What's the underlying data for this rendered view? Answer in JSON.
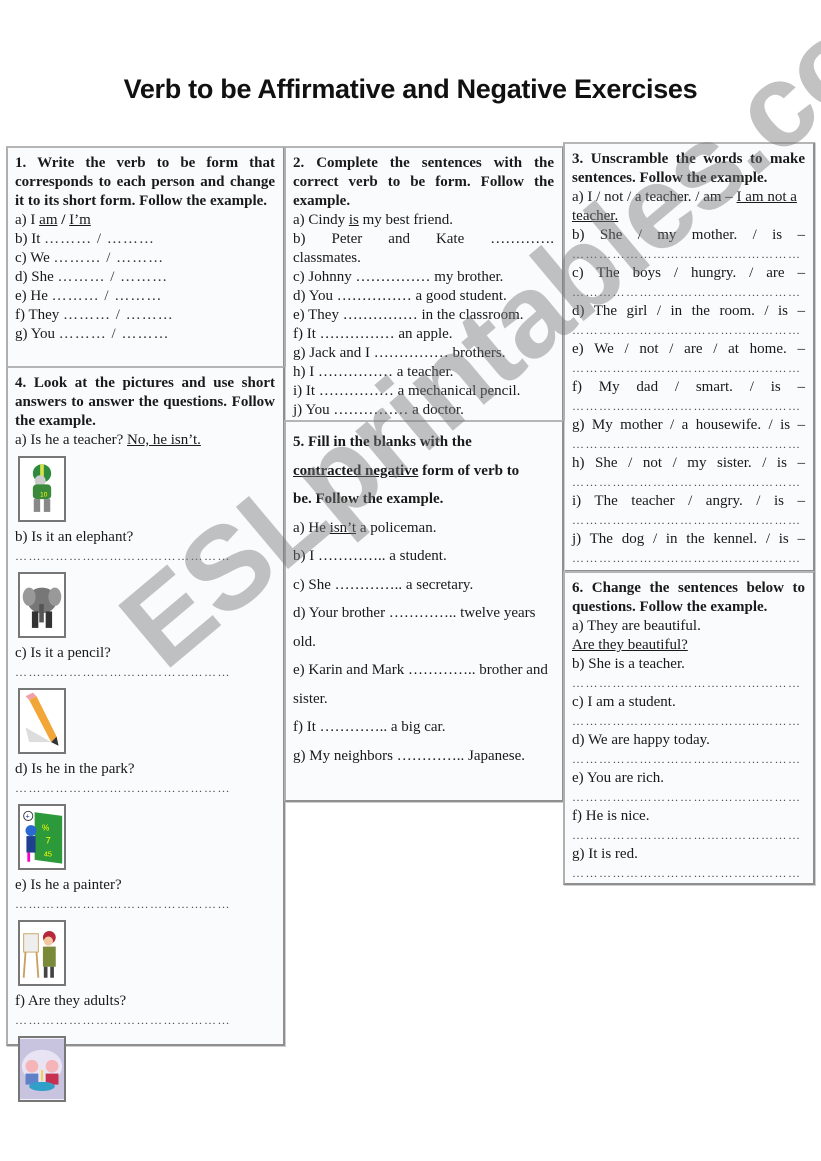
{
  "title": "Verb to be Affirmative and Negative Exercises",
  "watermark": "ESLprintables.com",
  "ex1": {
    "heading": "1. Write the verb to be form that corresponds to each person and change it to its short form. Follow the example.",
    "example": {
      "prefix": "a) I ",
      "answer1": "am",
      "sep": " / ",
      "answer2": "I’m"
    },
    "items": [
      {
        "label": "b) It",
        "blank": "……… / ………"
      },
      {
        "label": "c) We",
        "blank": "……… / ………"
      },
      {
        "label": "d) She",
        "blank": "……… / ………"
      },
      {
        "label": "e) He",
        "blank": "……… / ………"
      },
      {
        "label": "f) They",
        "blank": "……… / ………"
      },
      {
        "label": "g) You",
        "blank": "……… / ………"
      }
    ]
  },
  "ex2": {
    "heading": "2. Complete the sentences with the correct verb to be form. Follow the example.",
    "example": {
      "prefix": "a) Cindy ",
      "answer": "is",
      "suffix": " my best friend."
    },
    "item_b": {
      "line1": "b) Peter and Kate ………….",
      "line2": "classmates."
    },
    "items": [
      "c) Johnny …………… my brother.",
      "d) You …………… a good student.",
      "e) They …………… in the classroom.",
      "f) It …………… an apple.",
      "g) Jack and I …………… brothers.",
      "h) I …………… a teacher.",
      "i) It …………… a mechanical pencil.",
      "j) You …………… a doctor."
    ]
  },
  "ex3": {
    "heading": "3. Unscramble the words to make sentences. Follow the example.",
    "example": {
      "prompt": "a) I / not / a teacher. / am – ",
      "answer": "I am not a teacher."
    },
    "items": [
      "b) She / my mother. / is –",
      "c) The boys / hungry. / are –",
      "d) The girl / in the room. / is –",
      "e) We / not / are / at home. –",
      "f) My dad / smart. / is –",
      "g) My mother / a housewife. / is –",
      "h) She / not / my sister. / is –",
      "i) The teacher / angry. / is –",
      "j) The dog / in the kennel. / is –"
    ],
    "answer_line": "……………………………………………"
  },
  "ex4": {
    "heading": "4. Look at the pictures and use short answers to answer the questions. Follow the example.",
    "example": {
      "question": "a) Is he a teacher? ",
      "answer": "No, he isn’t."
    },
    "items": [
      {
        "question": "b) Is it an elephant?",
        "picture": "elephant"
      },
      {
        "question": "c) Is it a pencil?",
        "picture": "pencil"
      },
      {
        "question": "d) Is he in the park?",
        "picture": "boy-at-chalkboard"
      },
      {
        "question": "e) Is he a painter?",
        "picture": "painter"
      },
      {
        "question": "f) Are they adults?",
        "picture": "children-birthday"
      }
    ],
    "first_picture": "football-player",
    "answer_line": "…………………………………………"
  },
  "ex5": {
    "heading_line1": "5. Fill in the blanks with the",
    "heading_underlined": "contracted negative",
    "heading_rest": " form of verb to",
    "heading_line3": "be. Follow the example.",
    "example": {
      "prefix": "a) He ",
      "answer": "isn’t",
      "suffix": " a policeman."
    },
    "items": [
      "b) I ………….. a student.",
      "c) She ………….. a secretary.",
      "d) Your brother ………….. twelve years old.",
      "e) Karin and Mark ………….. brother and sister.",
      "f) It ………….. a big car.",
      "g) My neighbors ………….. Japanese."
    ]
  },
  "ex6": {
    "heading": "6. Change the sentences below to questions. Follow the example.",
    "example": {
      "sentence": "a) They are beautiful.",
      "answer": "Are they beautiful?"
    },
    "items": [
      "b) She is a teacher.",
      "c) I am a student.",
      "d) We are happy today.",
      "e) You are rich.",
      "f) He is nice.",
      "g) It is red."
    ],
    "answer_line": "……………………………………………"
  }
}
